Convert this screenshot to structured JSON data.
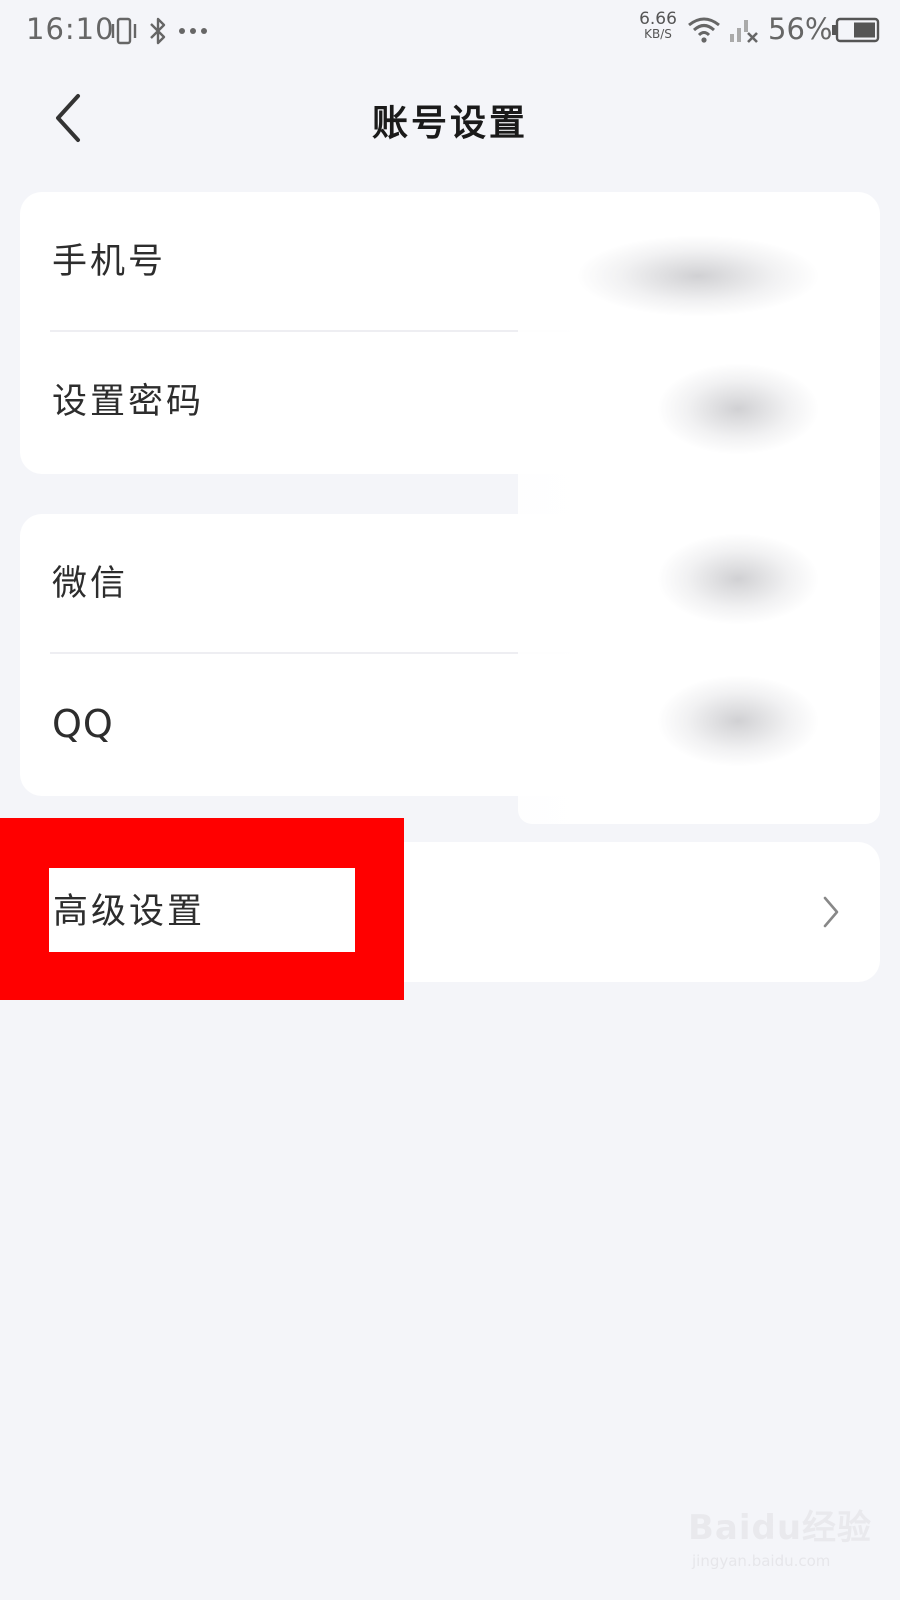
{
  "status_bar": {
    "time": "16:10",
    "net_speed_value": "6.66",
    "net_speed_unit": "KB/S",
    "battery": "56%",
    "icons": [
      "vibrate-icon",
      "bluetooth-icon",
      "more-dots-icon",
      "wifi-icon",
      "signal-off-icon",
      "battery-icon"
    ]
  },
  "header": {
    "title": "账号设置",
    "back_icon": "chevron-left-icon"
  },
  "card1": {
    "items": [
      {
        "label": "手机号"
      },
      {
        "label": "设置密码"
      }
    ]
  },
  "card2": {
    "items": [
      {
        "label": "微信"
      },
      {
        "label": "QQ"
      }
    ]
  },
  "advanced": {
    "label": "高级设置",
    "arrow_icon": "chevron-right-icon"
  },
  "annotation": {
    "highlight_color": "#ff0000"
  },
  "watermark": {
    "brand": "Baidu经验",
    "url": "jingyan.baidu.com"
  }
}
